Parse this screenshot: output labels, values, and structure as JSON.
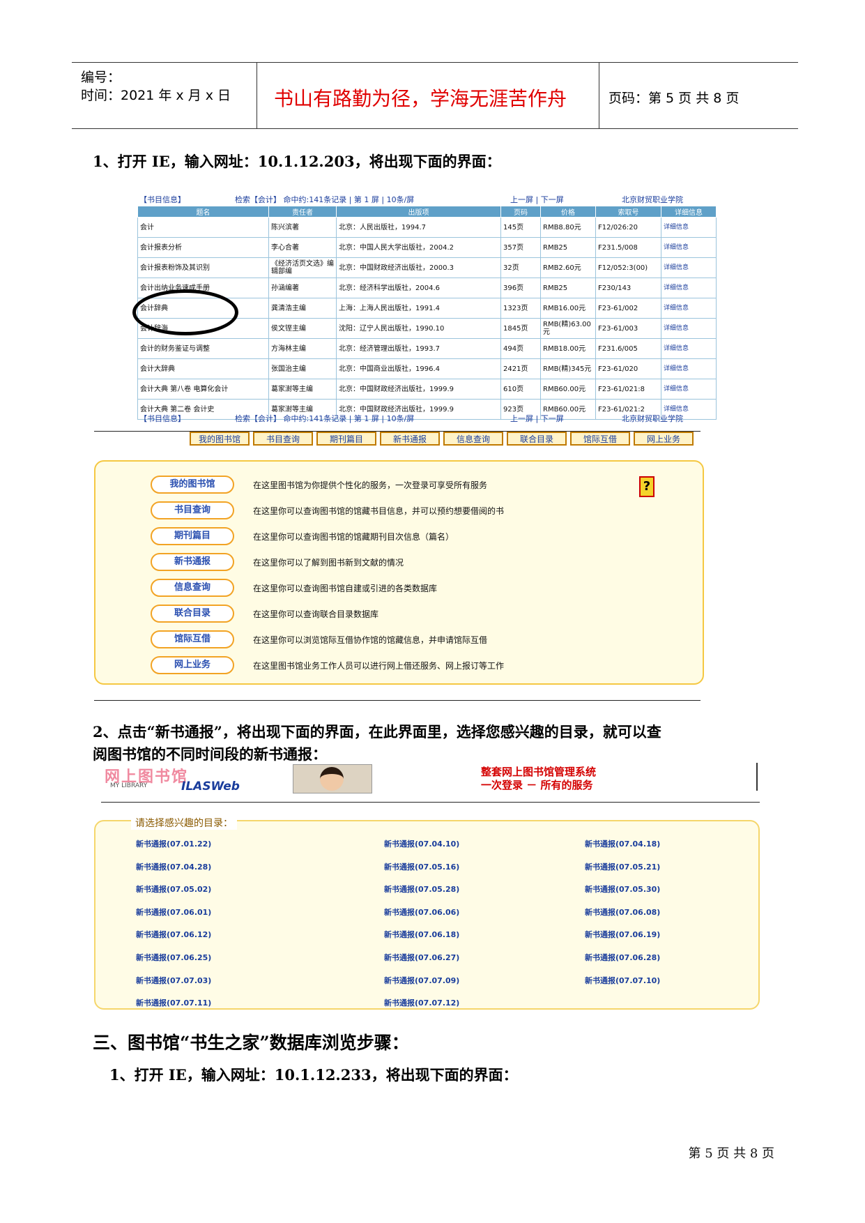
{
  "header": {
    "number_label": "编号：",
    "time_label": "时间：2021 年 x 月 x 日",
    "motto": "书山有路勤为径，学海无涯苦作舟",
    "page_label": "页码：第 5 页  共 8 页"
  },
  "step1": {
    "heading": "1、打开 IE，输入网址：10.1.12.203，将出现下面的界面："
  },
  "opac": {
    "bar": {
      "left": "【书目信息】",
      "search": "检索【会计】 命中约:141条记录 | 第 1 屏 | 10条/屏",
      "pager": "上一屏 | 下一屏",
      "school": "北京财贸职业学院"
    },
    "columns": [
      "题名",
      "责任者",
      "出版项",
      "页码",
      "价格",
      "索取号",
      "详细信息"
    ],
    "rows": [
      [
        "会计",
        "陈兴滨著",
        "北京：人民出版社，1994.7",
        "145页",
        "RMB8.80元",
        "F12/026:20",
        "详细信息"
      ],
      [
        "会计报表分析",
        "李心合著",
        "北京：中国人民大学出版社，2004.2",
        "357页",
        "RMB25",
        "F231.5/008",
        "详细信息"
      ],
      [
        "会计报表粉饰及其识别",
        "《经济活页文选》编辑部编",
        "北京：中国财政经济出版社，2000.3",
        "32页",
        "RMB2.60元",
        "F12/052:3(00)",
        "详细信息"
      ],
      [
        "会计出纳业务速成手册",
        "孙涵编著",
        "北京：经济科学出版社，2004.6",
        "396页",
        "RMB25",
        "F230/143",
        "详细信息"
      ],
      [
        "会计辞典",
        "龚清浩主编",
        "上海：上海人民出版社，1991.4",
        "1323页",
        "RMB16.00元",
        "F23-61/002",
        "详细信息"
      ],
      [
        "会计辞海",
        "侯文铿主编",
        "沈阳：辽宁人民出版社，1990.10",
        "1845页",
        "RMB(精)63.00元",
        "F23-61/003",
        "详细信息"
      ],
      [
        "会计的财务鉴证与调整",
        "方海林主编",
        "北京：经济管理出版社，1993.7",
        "494页",
        "RMB18.00元",
        "F231.6/005",
        "详细信息"
      ],
      [
        "会计大辞典",
        "张国治主编",
        "北京：中国商业出版社，1996.4",
        "2421页",
        "RMB(精)345元",
        "F23-61/020",
        "详细信息"
      ],
      [
        "会计大典 第八卷 电算化会计",
        "葛家澍等主编",
        "北京：中国财政经济出版社，1999.9",
        "610页",
        "RMB60.00元",
        "F23-61/021:8",
        "详细信息"
      ],
      [
        "会计大典 第二卷 会计史",
        "葛家澍等主编",
        "北京：中国财政经济出版社，1999.9",
        "923页",
        "RMB60.00元",
        "F23-61/021:2",
        "详细信息"
      ]
    ],
    "tabs": [
      "我的图书馆",
      "书目查询",
      "期刊篇目",
      "新书通报",
      "信息查询",
      "联合目录",
      "馆际互借",
      "网上业务"
    ],
    "services": [
      {
        "label": "我的图书馆",
        "desc": "在这里图书馆为你提供个性化的服务，一次登录可享受所有服务"
      },
      {
        "label": "书目查询",
        "desc": "在这里你可以查询图书馆的馆藏书目信息，并可以预约想要借阅的书"
      },
      {
        "label": "期刊篇目",
        "desc": "在这里你可以查询图书馆的馆藏期刊目次信息（篇名）"
      },
      {
        "label": "新书通报",
        "desc": "在这里你可以了解到图书新到文献的情况"
      },
      {
        "label": "信息查询",
        "desc": "在这里你可以查询图书馆自建或引进的各类数据库"
      },
      {
        "label": "联合目录",
        "desc": "在这里你可以查询联合目录数据库"
      },
      {
        "label": "馆际互借",
        "desc": "在这里你可以浏览馆际互借协作馆的馆藏信息，并申请馆际互借"
      },
      {
        "label": "网上业务",
        "desc": "在这里图书馆业务工作人员可以进行网上借还服务、网上报订等工作"
      }
    ],
    "help_symbol": "?"
  },
  "step2": {
    "heading_line1": "2、点击“新书通报”，将出现下面的界面，在此界面里，选择您感兴趣的目录，就可以查",
    "heading_line2": "阅图书馆的不同时间段的新书通报："
  },
  "newbooks": {
    "logo_cn": "网上图书馆",
    "logo_en": "MY LIBRARY",
    "logo_brand": "ILASWeb",
    "slogan_line1": "整套网上图书馆管理系统",
    "slogan_line2": "一次登录  －  所有的服务",
    "select_label": "请选择感兴趣的目录：",
    "links": [
      "新书通报(07.01.22)",
      "新书通报(07.04.10)",
      "新书通报(07.04.18)",
      "新书通报(07.04.28)",
      "新书通报(07.05.16)",
      "新书通报(07.05.21)",
      "新书通报(07.05.02)",
      "新书通报(07.05.28)",
      "新书通报(07.05.30)",
      "新书通报(07.06.01)",
      "新书通报(07.06.06)",
      "新书通报(07.06.08)",
      "新书通报(07.06.12)",
      "新书通报(07.06.18)",
      "新书通报(07.06.19)",
      "新书通报(07.06.25)",
      "新书通报(07.06.27)",
      "新书通报(07.06.28)",
      "新书通报(07.07.03)",
      "新书通报(07.07.09)",
      "新书通报(07.07.10)",
      "新书通报(07.07.11)",
      "新书通报(07.07.12)"
    ]
  },
  "section3": {
    "heading": "三、图书馆“书生之家”数据库浏览步骤：",
    "step1": "1、打开 IE，输入网址：10.1.12.233，将出现下面的界面："
  },
  "footer": {
    "page": "第 5 页 共 8 页"
  }
}
